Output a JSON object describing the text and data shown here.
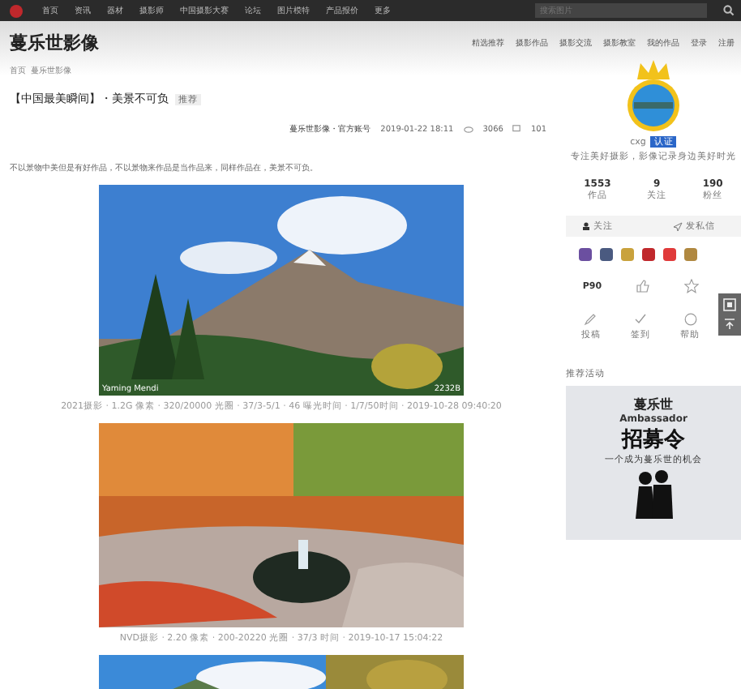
{
  "top_bar": {
    "items": [
      "首页",
      "资讯",
      "器材",
      "摄影师",
      "中国摄影大赛",
      "论坛",
      "图片模特",
      "产品报价",
      "更多"
    ],
    "search": {
      "placeholder": "搜索图片"
    }
  },
  "site": {
    "logo": "蔓乐世影像",
    "nav": [
      "精选推荐",
      "摄影作品",
      "摄影交流",
      "摄影教室",
      "我的作品",
      "登录",
      "注册"
    ]
  },
  "breadcrumb": [
    "首页",
    "蔓乐世影像"
  ],
  "article": {
    "title": "【中国最美瞬间】・美景不可负",
    "tag": "推荐",
    "author": "蔓乐世影像・官方账号",
    "date": "2019-01-22 18:11",
    "views": "3066",
    "comments": "101",
    "intro": "不以景物中美但是有好作品，不以景物来作品是当作品来，同样作品在，美景不可负。",
    "photos": [
      {
        "kind": "picture",
        "credit": "Yaming Mendi",
        "size": "2232B",
        "caption": "2021摄影 · 1.2G 像素 · 320/20000 光圈 · 37/3-5/1 · 46 曝光时间 · 1/7/50时间 · 2019-10-28 09:40:20"
      },
      {
        "kind": "picture",
        "caption": "NVD摄影 · 2.20 像素 · 200-20220 光圈 · 37/3 时间 · 2019-10-17 15:04:22"
      },
      {
        "kind": "picture"
      }
    ]
  },
  "profile": {
    "name": "cxg",
    "badge": "认证",
    "bio": "专注美好摄影，影像记录身边美好时光",
    "stats": [
      {
        "value": "1553",
        "label": "作品"
      },
      {
        "value": "9",
        "label": "关注"
      },
      {
        "value": "190",
        "label": "粉丝"
      }
    ],
    "follow": "关注",
    "message": "发私信",
    "medals": [
      {
        "color": "#6b4fa0"
      },
      {
        "color": "#4a5a80"
      },
      {
        "color": "#c9a23c"
      },
      {
        "color": "#c0282c"
      },
      {
        "color": "#e03a3a"
      },
      {
        "color": "#b08840"
      }
    ],
    "level": "P90",
    "actions": [
      "投稿",
      "签到",
      "帮助"
    ]
  },
  "sidebar_ad": {
    "heading": "推荐活动",
    "brand": "蔓乐世",
    "word": "Ambassador",
    "title": "招募令",
    "sub": "一个成为蔓乐世的机会"
  }
}
